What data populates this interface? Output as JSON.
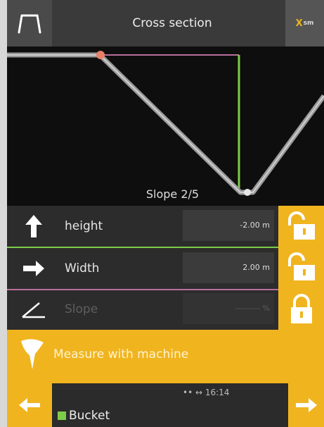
{
  "header": {
    "title": "Cross section",
    "close_label": "X",
    "close_sub": "sm"
  },
  "canvas": {
    "slope_label": "Slope 2/5"
  },
  "rows": [
    {
      "label": "height",
      "value": "-2.00 m",
      "locked": false,
      "enabled": true,
      "sep_color": "#7ccc4a"
    },
    {
      "label": "Width",
      "value": "2.00 m",
      "locked": false,
      "enabled": true,
      "sep_color": "#b86f9c"
    },
    {
      "label": "Slope",
      "value": "--------- %",
      "locked": true,
      "enabled": false,
      "sep_color": "#888888"
    }
  ],
  "measure": {
    "label": "Measure with machine"
  },
  "footer": {
    "status": "••  ↔  16:14",
    "tool": "Bucket"
  },
  "colors": {
    "accent": "#f0b41f",
    "green": "#7ccc4a",
    "magenta": "#b86f9c"
  }
}
